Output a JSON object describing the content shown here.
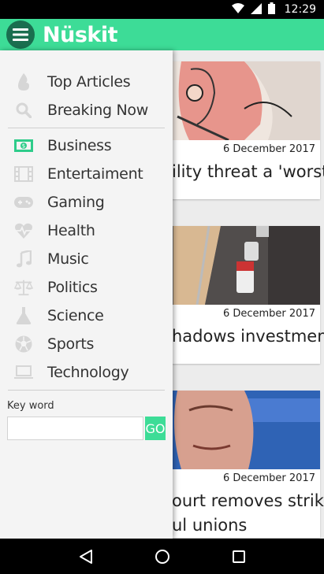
{
  "status_bar": {
    "time": "12:29"
  },
  "app_bar": {
    "title": "Nüskit"
  },
  "drawer": {
    "items": [
      {
        "label": "Top Articles",
        "icon": "fire-icon"
      },
      {
        "label": "Breaking Now",
        "icon": "search-icon"
      },
      {
        "label": "Business",
        "icon": "money-icon"
      },
      {
        "label": "Entertaiment",
        "icon": "film-icon"
      },
      {
        "label": "Gaming",
        "icon": "gamepad-icon"
      },
      {
        "label": "Health",
        "icon": "heartbeat-icon"
      },
      {
        "label": "Music",
        "icon": "music-note-icon"
      },
      {
        "label": "Politics",
        "icon": "scales-icon"
      },
      {
        "label": "Science",
        "icon": "flask-icon"
      },
      {
        "label": "Sports",
        "icon": "soccer-ball-icon"
      },
      {
        "label": "Technology",
        "icon": "laptop-icon"
      }
    ],
    "keyword_label": "Key word",
    "keyword_value": "",
    "keyword_placeholder": "",
    "go_label": "GO"
  },
  "articles": [
    {
      "date": "6 December 2017",
      "title": "ility threat a 'worst"
    },
    {
      "date": "6 December 2017",
      "title": "hadows investment"
    },
    {
      "date": "6 December 2017",
      "title": "ourt removes strike",
      "title2": "ul unions"
    }
  ],
  "colors": {
    "accent": "#3ddc97",
    "accent_dark": "#1a6e4f",
    "active_icon": "#2ecc8a"
  }
}
